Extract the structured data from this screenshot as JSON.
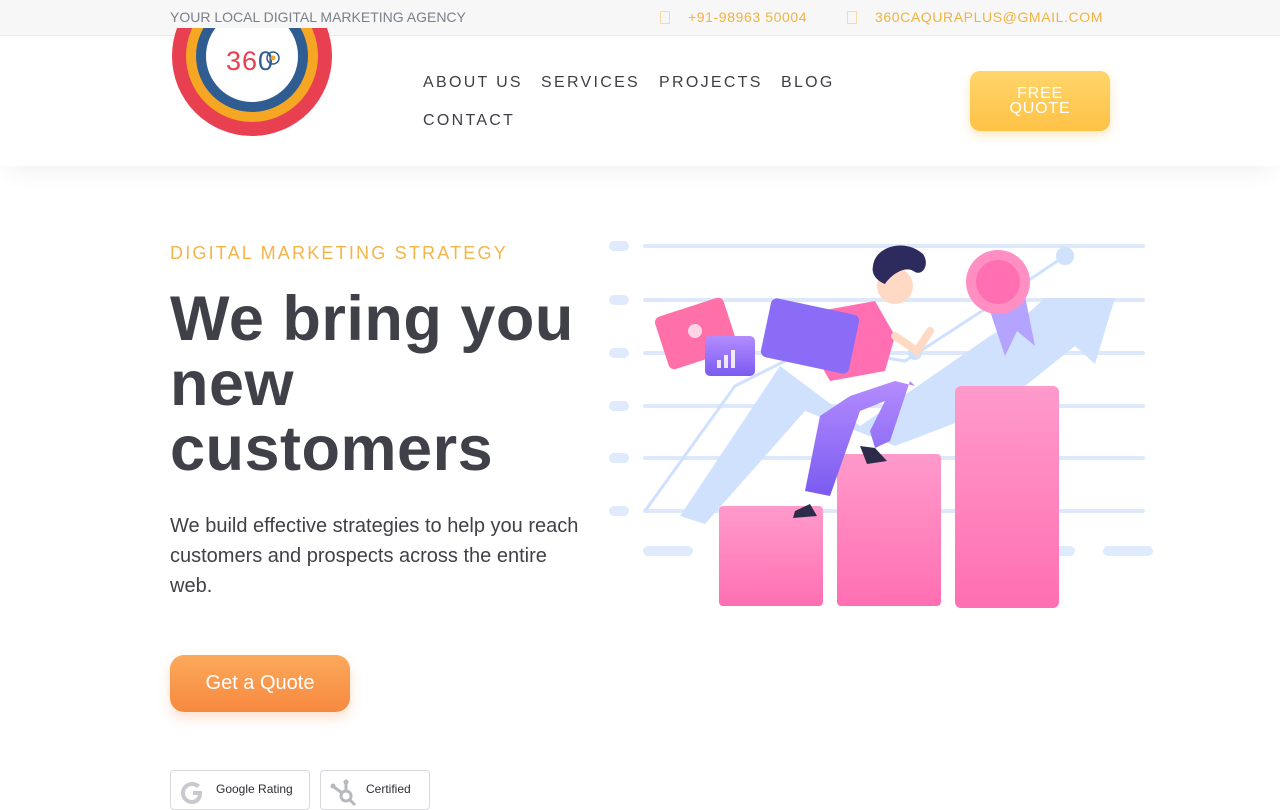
{
  "topbar": {
    "tagline": "YOUR LOCAL DIGITAL MARKETING AGENCY",
    "phone": "+91-98963 50004",
    "email": "360CAQURAPLUS@GMAIL.COM",
    "phone_icon": "phone-icon",
    "email_icon": "mail-icon"
  },
  "brand": {
    "logo_text": "360",
    "colors": {
      "ring_outer": "#e84050",
      "ring_middle": "#f5a623",
      "ring_inner": "#2f5d91"
    }
  },
  "nav": {
    "items": [
      {
        "label": "ABOUT US"
      },
      {
        "label": "SERVICES"
      },
      {
        "label": "PROJECTS"
      },
      {
        "label": "BLOG"
      },
      {
        "label": "CONTACT"
      }
    ],
    "cta": "FREE QUOTE"
  },
  "hero": {
    "eyebrow": "DIGITAL MARKETING STRATEGY",
    "headline": "We bring you new customers",
    "subtext": "We build effective strategies to help you reach customers and prospects across the entire web.",
    "cta": "Get a Quote"
  },
  "badges": [
    {
      "label": "Google Rating",
      "icon": "google-icon"
    },
    {
      "label": "Certified",
      "icon": "hubspot-icon"
    }
  ],
  "colors": {
    "accent_yellow": "#ffc247",
    "accent_orange": "#f78940",
    "eyebrow": "#f5b44a",
    "text": "#404148"
  }
}
